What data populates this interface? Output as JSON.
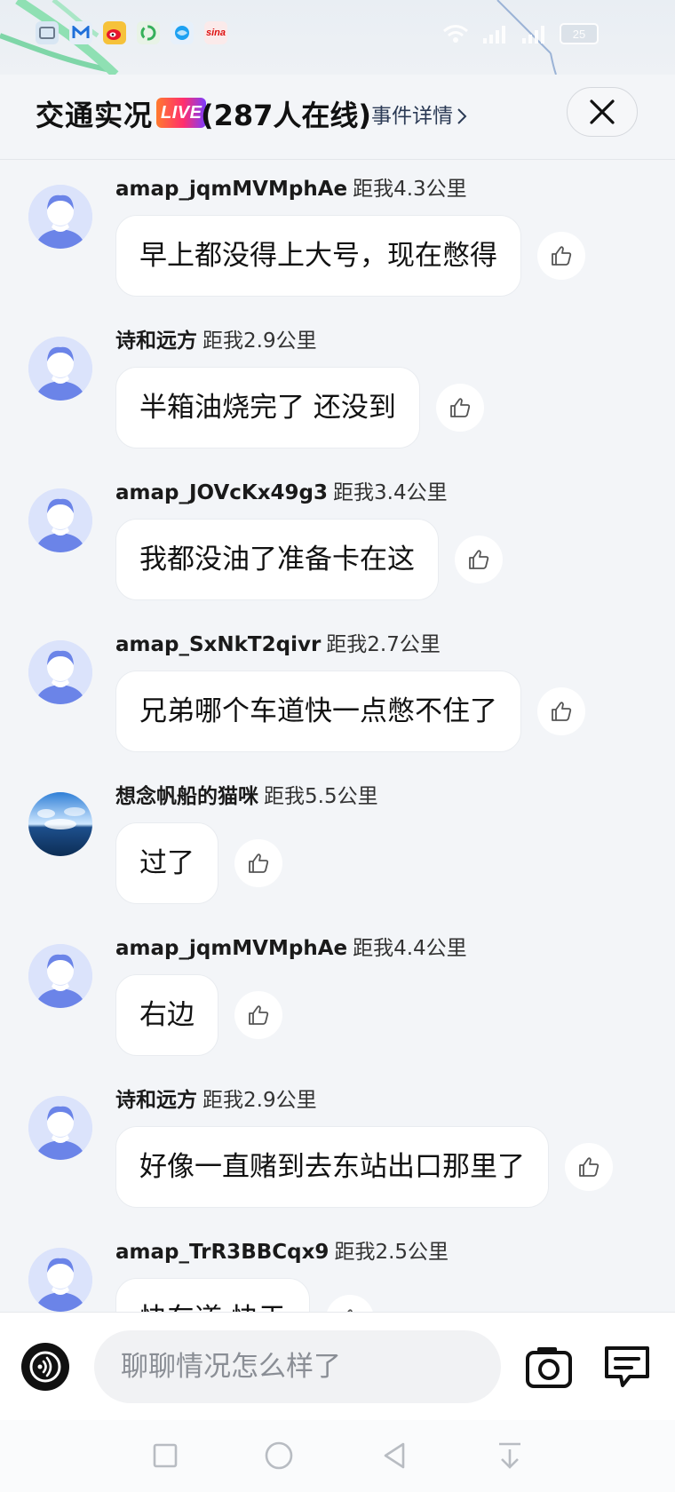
{
  "status_bar": {
    "app_icons": [
      "message-icon",
      "maxthon-icon",
      "weibo-icon",
      "recycle-app-icon",
      "browser-icon",
      "sina-icon"
    ],
    "sina_label": "sina",
    "battery": "25",
    "signal_icons": [
      "wifi-icon",
      "signal-icon",
      "signal-icon",
      "battery-icon"
    ]
  },
  "header": {
    "title": "交通实况",
    "live_badge": "LIVE",
    "online_count": "(287人在线)",
    "event_details": "事件详情",
    "close_icon": "close-icon"
  },
  "colors": {
    "page_bg": "#f3f5f8",
    "bubble_bg": "#ffffff",
    "avatar_bg": "#dbe3fb",
    "avatar_figure": "#6b84e8",
    "live_gradient": [
      "#ff7a2e",
      "#ff2e6e",
      "#7b3cff"
    ]
  },
  "messages": [
    {
      "username": "amap_jqmMVMphAe",
      "distance": "距我4.3公里",
      "text": "早上都没得上大号，现在憋得",
      "avatar": "default"
    },
    {
      "username": "诗和远方",
      "distance": "距我2.9公里",
      "text": "半箱油烧完了 还没到",
      "avatar": "default"
    },
    {
      "username": "amap_JOVcKx49g3",
      "distance": "距我3.4公里",
      "text": "我都没油了准备卡在这",
      "avatar": "default"
    },
    {
      "username": "amap_SxNkT2qivr",
      "distance": "距我2.7公里",
      "text": "兄弟哪个车道快一点憋不住了",
      "avatar": "default"
    },
    {
      "username": "想念帆船的猫咪",
      "distance": "距我5.5公里",
      "text": "过了",
      "avatar": "ocean-photo"
    },
    {
      "username": "amap_jqmMVMphAe",
      "distance": "距我4.4公里",
      "text": "右边",
      "avatar": "default"
    },
    {
      "username": "诗和远方",
      "distance": "距我2.9公里",
      "text": "好像一直赌到去东站出口那里了",
      "avatar": "default"
    },
    {
      "username": "amap_TrR3BBCqx9",
      "distance": "距我2.5公里",
      "text": "快车道 快于",
      "avatar": "default"
    }
  ],
  "input_bar": {
    "placeholder": "聊聊情况怎么样了",
    "voice_icon": "voice-icon",
    "camera_icon": "camera-icon",
    "comment_icon": "comment-icon"
  },
  "nav": {
    "buttons": [
      "recents-square-icon",
      "home-circle-icon",
      "back-triangle-icon",
      "notification-pulldown-icon"
    ]
  }
}
